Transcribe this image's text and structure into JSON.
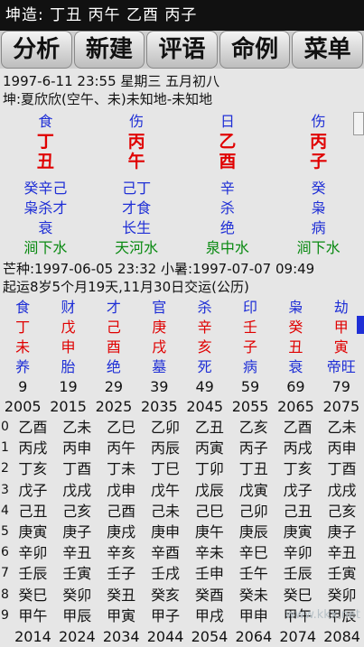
{
  "statusbar": {
    "text": "坤造:  丁丑    丙午    乙酉    丙子"
  },
  "toolbar": [
    "分析",
    "新建",
    "评语",
    "命例",
    "菜单"
  ],
  "info": {
    "date_line": "1997-6-11 23:55  星期三  五月初八",
    "person_line": "坤:夏欣欣(空午、未)未知地-未知地"
  },
  "pillars": {
    "gods": [
      "食",
      "伤",
      "日",
      "伤"
    ],
    "stems": [
      "丁",
      "丙",
      "乙",
      "丙"
    ],
    "branches": [
      "丑",
      "午",
      "酉",
      "子"
    ],
    "hidden": [
      "癸辛己",
      "己丁",
      "辛",
      "癸"
    ],
    "hidden_gods": [
      "枭杀才",
      "才食",
      "杀",
      "枭"
    ],
    "stage": [
      "衰",
      "长生",
      "绝",
      "病"
    ],
    "nayin": [
      "涧下水",
      "天河水",
      "泉中水",
      "涧下水"
    ]
  },
  "terms": {
    "line1": "芒种:1997-06-05 23:32  小暑:1997-07-07 09:49",
    "line2": "起运8岁5个月19天,11月30日交运(公历)"
  },
  "dayun": {
    "gods": [
      "食",
      "财",
      "才",
      "官",
      "杀",
      "印",
      "枭",
      "劫"
    ],
    "stems": [
      "丁",
      "戊",
      "己",
      "庚",
      "辛",
      "壬",
      "癸",
      "甲"
    ],
    "branches": [
      "未",
      "申",
      "酉",
      "戌",
      "亥",
      "子",
      "丑",
      "寅"
    ],
    "stages": [
      "养",
      "胎",
      "绝",
      "墓",
      "死",
      "病",
      "衰",
      "帝旺"
    ],
    "ages": [
      "9",
      "19",
      "29",
      "39",
      "49",
      "59",
      "69",
      "79"
    ],
    "years": [
      "2005",
      "2015",
      "2025",
      "2035",
      "2045",
      "2055",
      "2065",
      "2075"
    ]
  },
  "liunian": {
    "rows": [
      {
        "idx": "0",
        "v": [
          "乙酉",
          "乙未",
          "乙巳",
          "乙卯",
          "乙丑",
          "乙亥",
          "乙酉",
          "乙未"
        ]
      },
      {
        "idx": "1",
        "v": [
          "丙戌",
          "丙申",
          "丙午",
          "丙辰",
          "丙寅",
          "丙子",
          "丙戌",
          "丙申"
        ]
      },
      {
        "idx": "2",
        "v": [
          "丁亥",
          "丁酉",
          "丁未",
          "丁巳",
          "丁卯",
          "丁丑",
          "丁亥",
          "丁酉"
        ]
      },
      {
        "idx": "3",
        "v": [
          "戊子",
          "戊戌",
          "戊申",
          "戊午",
          "戊辰",
          "戊寅",
          "戊子",
          "戊戌"
        ]
      },
      {
        "idx": "4",
        "v": [
          "己丑",
          "己亥",
          "己酉",
          "己未",
          "己巳",
          "己卯",
          "己丑",
          "己亥"
        ]
      },
      {
        "idx": "5",
        "v": [
          "庚寅",
          "庚子",
          "庚戌",
          "庚申",
          "庚午",
          "庚辰",
          "庚寅",
          "庚子"
        ]
      },
      {
        "idx": "6",
        "v": [
          "辛卯",
          "辛丑",
          "辛亥",
          "辛酉",
          "辛未",
          "辛巳",
          "辛卯",
          "辛丑"
        ]
      },
      {
        "idx": "7",
        "v": [
          "壬辰",
          "壬寅",
          "壬子",
          "壬戌",
          "壬申",
          "壬午",
          "壬辰",
          "壬寅"
        ]
      },
      {
        "idx": "8",
        "v": [
          "癸巳",
          "癸卯",
          "癸丑",
          "癸亥",
          "癸酉",
          "癸未",
          "癸巳",
          "癸卯"
        ]
      },
      {
        "idx": "9",
        "v": [
          "甲午",
          "甲辰",
          "甲寅",
          "甲子",
          "甲戌",
          "甲申",
          "甲午",
          "甲辰"
        ]
      }
    ],
    "end_years": [
      "2014",
      "2024",
      "2034",
      "2044",
      "2054",
      "2064",
      "2074",
      "2084"
    ]
  },
  "watermark": "www.kkx.net"
}
